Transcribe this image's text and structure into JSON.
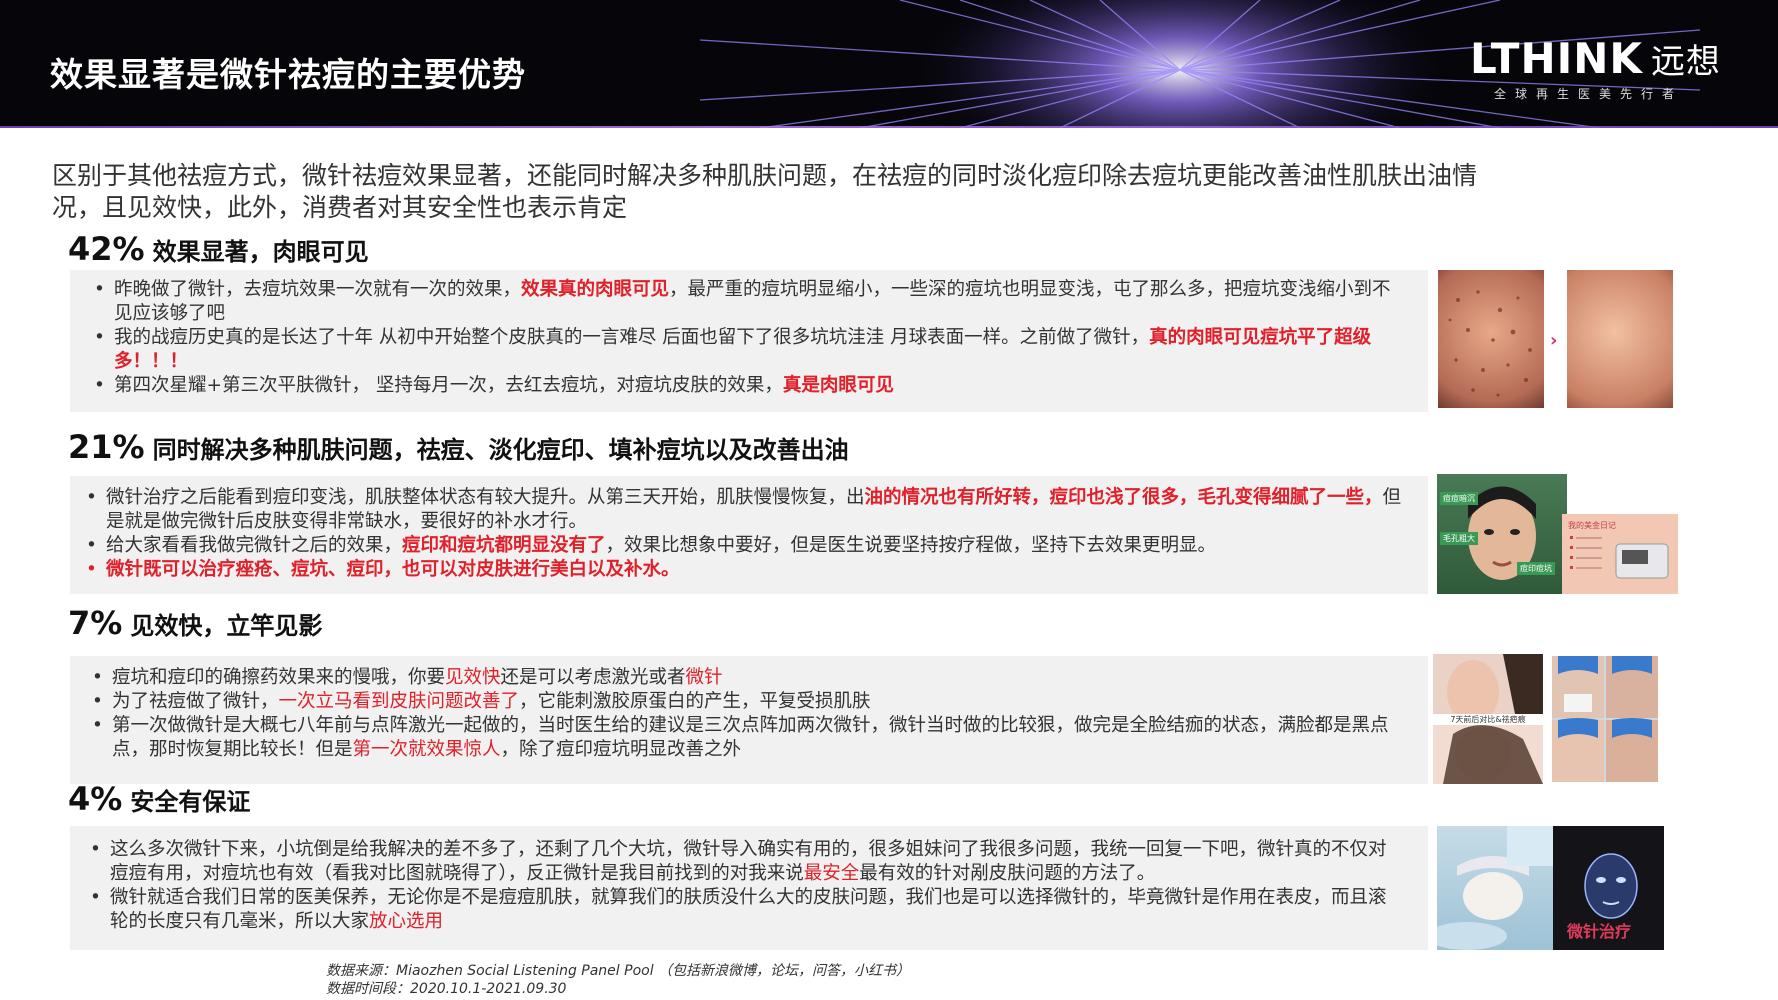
{
  "header": {
    "title": "效果显著是微针祛痘的主要优势",
    "logo_main": "LTHINK",
    "logo_cn": "远想",
    "logo_sub": "全球再生医美先行者"
  },
  "intro": {
    "line1": "区别于其他祛痘方式，微针祛痘效果显著，还能同时解决多种肌肤问题，在祛痘的同时淡化痘印除去痘坑更能改善油性肌肤出油情",
    "line2": "况，且见效快，此外，消费者对其安全性也表示肯定"
  },
  "sections": [
    {
      "pct": "42%",
      "label": "效果显著，肉眼可见",
      "bullets": [
        {
          "a": "昨晚做了微针，去痘坑效果一次就有一次的效果，",
          "b": "效果真的肉眼可见",
          "c": "，最严重的痘坑明显缩小，一些深的痘坑也明显变浅，屯了那么多，把痘坑变浅缩小到不见应该够了吧"
        },
        {
          "a": "我的战痘历史真的是长达了十年 从初中开始整个皮肤真的一言难尽 后面也留下了很多坑坑洼洼 月球表面一样。之前做了微针，",
          "b": "真的肉眼可见痘坑平了超级多！！！",
          "c": ""
        },
        {
          "a": "第四次星耀+第三次平肤微针， 坚持每月一次，去红去痘坑，对痘坑皮肤的效果，",
          "b": "真是肉眼可见",
          "c": ""
        }
      ]
    },
    {
      "pct": "21%",
      "label": "同时解决多种肌肤问题，祛痘、淡化痘印、填补痘坑以及改善出油",
      "bullets": [
        {
          "a": "微针治疗之后能看到痘印变浅，肌肤整体状态有较大提升。从第三天开始，肌肤慢慢恢复，出",
          "b": "油的情况也有所好转，痘印也浅了很多，毛孔变得细腻了一些，",
          "c": "但是就是做完微针后皮肤变得非常缺水，要很好的补水才行。"
        },
        {
          "a": "给大家看看我做完微针之后的效果，",
          "b": "痘印和痘坑都明显没有了",
          "c": "，效果比想象中要好，但是医生说要坚持按疗程做，坚持下去效果更明显。"
        },
        {
          "a": "",
          "b": "微针既可以治疗痤疮、痘坑、痘印，也可以对皮肤进行美白以及补水。",
          "c": ""
        }
      ]
    },
    {
      "pct": "7%",
      "label": "见效快，立竿见影",
      "bullets": [
        {
          "a": "痘坑和痘印的确擦药效果来的慢哦，你要",
          "b": "见效快",
          "c": "还是可以考虑激光或者",
          "d": "微针",
          "e": ""
        },
        {
          "a": "为了祛痘做了微针，",
          "b": "一次立马看到皮肤问题改善了",
          "c": "，它能刺激胶原蛋白的产生，平复受损肌肤",
          "d": "",
          "e": ""
        },
        {
          "a": "第一次做微针是大概七八年前与点阵激光一起做的，当时医生给的建议是三次点阵加两次微针，微针当时做的比较狠，做完是全脸结痂的状态，满脸都是黑点点，那时恢复期比较长！但是",
          "b": "第一次就效果惊人",
          "c": "，除了痘印痘坑明显改善之外",
          "d": "",
          "e": ""
        }
      ]
    },
    {
      "pct": "4%",
      "label": "安全有保证",
      "bullets": [
        {
          "a": "这么多次微针下来，小坑倒是给我解决的差不多了，还剩了几个大坑，微针导入确实有用的，很多姐妹问了我很多问题，我统一回复一下吧，微针真的不仅对痘痘有用，对痘坑也有效（看我对比图就晓得了），反正微针是我目前找到的对我来说",
          "b": "最安全",
          "c": "最有效的针对剐皮肤问题的方法了。"
        },
        {
          "a": "微针就适合我们日常的医美保养，无论你是不是痘痘肌肤，就算我们的肤质没什么大的皮肤问题，我们也是可以选择微针的，毕竟微针是作用在表皮，而且滚轮的长度只有几毫米，所以大家",
          "b": "放心选用",
          "c": ""
        }
      ]
    }
  ],
  "photo_text": {
    "s2_tag1": "痘痘暗沉",
    "s2_tag2": "毛孔粗大",
    "s2_tag3": "痘印痘坑",
    "s2_card": "我的美金日记",
    "s3_caption": "7天前后对比&祛疤痕",
    "s4_caption": "微针治疗"
  },
  "source": {
    "line1": "数据来源：Miaozhen Social Listening Panel Pool （包括新浪微博，论坛，问答，小红书）",
    "line2": "数据时间段：2020.10.1-2021.09.30"
  },
  "colors": {
    "accent": "#e0202a",
    "header_bg": "#06060a",
    "panel_bg": "#f1f1f1",
    "ray": "#8a6cff"
  }
}
